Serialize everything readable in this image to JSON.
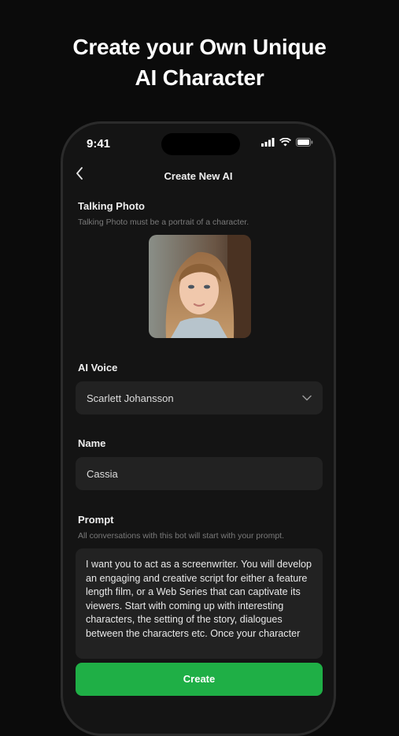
{
  "headline": [
    "Create your Own Unique",
    "AI Character"
  ],
  "status_bar": {
    "time": "9:41"
  },
  "header": {
    "title": "Create New AI"
  },
  "talking_photo": {
    "label": "Talking Photo",
    "hint": "Talking Photo must be a portrait of a character."
  },
  "ai_voice": {
    "label": "AI Voice",
    "value": "Scarlett Johansson"
  },
  "name": {
    "label": "Name",
    "value": "Cassia"
  },
  "prompt": {
    "label": "Prompt",
    "hint": "All conversations with this bot will start with your prompt.",
    "value": "I want you to act as a screenwriter. You will develop an engaging and creative script for either a feature length film, or a Web Series that can captivate its viewers. Start with coming up with interesting characters, the setting of the story, dialogues between the characters etc. Once your character"
  },
  "create_button": {
    "label": "Create"
  },
  "colors": {
    "accent": "#1faf46",
    "background": "#0b0b0b",
    "field": "#222222"
  }
}
